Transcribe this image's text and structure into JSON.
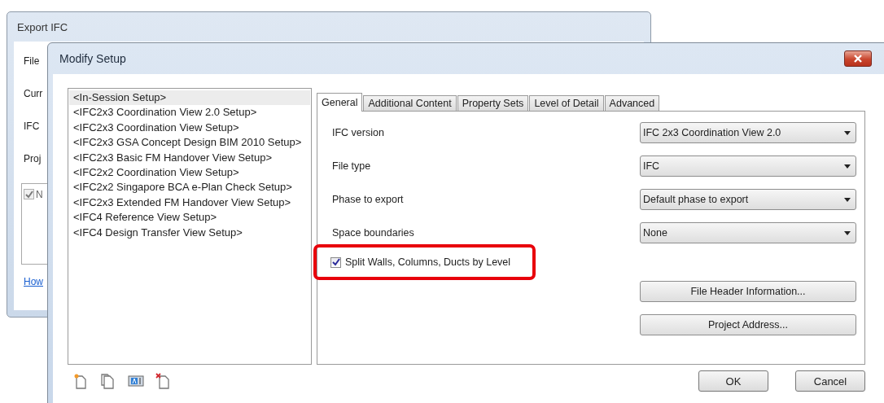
{
  "back_window": {
    "title": "Export IFC",
    "labels": [
      "File",
      "Curr",
      "IFC",
      "Proj"
    ],
    "group_checkbox": {
      "label": "N",
      "checked": true,
      "disabled": true
    },
    "link": "How"
  },
  "window": {
    "title": "Modify Setup"
  },
  "setups": [
    {
      "label": "<In-Session Setup>",
      "selected": true
    },
    {
      "label": "<IFC2x3 Coordination View 2.0 Setup>",
      "selected": false
    },
    {
      "label": "<IFC2x3 Coordination View Setup>",
      "selected": false
    },
    {
      "label": "<IFC2x3 GSA Concept Design BIM 2010 Setup>",
      "selected": false
    },
    {
      "label": "<IFC2x3 Basic FM Handover View Setup>",
      "selected": false
    },
    {
      "label": "<IFC2x2 Coordination View Setup>",
      "selected": false
    },
    {
      "label": "<IFC2x2 Singapore BCA e-Plan Check Setup>",
      "selected": false
    },
    {
      "label": "<IFC2x3 Extended FM Handover View Setup>",
      "selected": false
    },
    {
      "label": "<IFC4 Reference View Setup>",
      "selected": false
    },
    {
      "label": "<IFC4 Design Transfer View Setup>",
      "selected": false
    }
  ],
  "tabs": [
    {
      "label": "General",
      "selected": true
    },
    {
      "label": "Additional Content",
      "selected": false
    },
    {
      "label": "Property Sets",
      "selected": false
    },
    {
      "label": "Level of Detail",
      "selected": false
    },
    {
      "label": "Advanced",
      "selected": false
    }
  ],
  "fields": [
    {
      "label": "IFC version",
      "value": "IFC 2x3 Coordination View 2.0"
    },
    {
      "label": "File type",
      "value": "IFC"
    },
    {
      "label": "Phase to export",
      "value": "Default phase to export"
    },
    {
      "label": "Space boundaries",
      "value": "None"
    }
  ],
  "split_option": {
    "label": "Split Walls, Columns, Ducts by Level",
    "checked": true,
    "highlighted": true
  },
  "panel_buttons": [
    "File Header Information...",
    "Project Address..."
  ],
  "dialog_buttons": [
    "OK",
    "Cancel"
  ]
}
